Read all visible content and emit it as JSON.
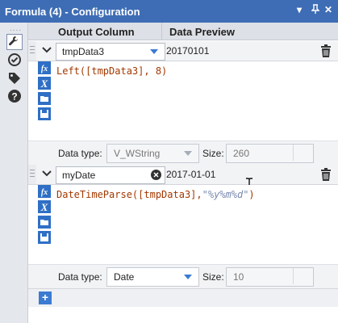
{
  "window": {
    "title": "Formula (4) - Configuration",
    "controls": [
      "▾",
      "✕"
    ]
  },
  "sidebar": {
    "grip": "....",
    "icons": [
      "wrench-icon",
      "tag-check-icon",
      "tag-icon",
      "help-icon"
    ]
  },
  "header": {
    "output_column": "Output Column",
    "data_preview": "Data Preview"
  },
  "formulas": [
    {
      "column": "tmpData3",
      "preview": "20170101",
      "expression_parts": [
        {
          "text": "Left([tmpData3], 8)",
          "style": "code"
        }
      ],
      "data_type_label": "Data type:",
      "data_type": "V_WString",
      "size_label": "Size:",
      "size": "260"
    },
    {
      "column": "myDate",
      "preview": "2017-01-01",
      "expression_parts": [
        {
          "text": "DateTimeParse([tmpData3],",
          "style": "code"
        },
        {
          "text": "\"%y%m%d\"",
          "style": "str"
        },
        {
          "text": ")",
          "style": "code"
        }
      ],
      "data_type_label": "Data type:",
      "data_type": "Date",
      "size_label": "Size:",
      "size": "10"
    }
  ],
  "editor_icons": [
    "fx-icon",
    "variable-x-icon",
    "folder-open-icon",
    "save-icon"
  ],
  "add_button": "+",
  "colors": {
    "titlebar": "#3e6db5",
    "accent": "#3b7bd2",
    "function_text": "#a23800",
    "string_text": "#7a8ab0"
  }
}
